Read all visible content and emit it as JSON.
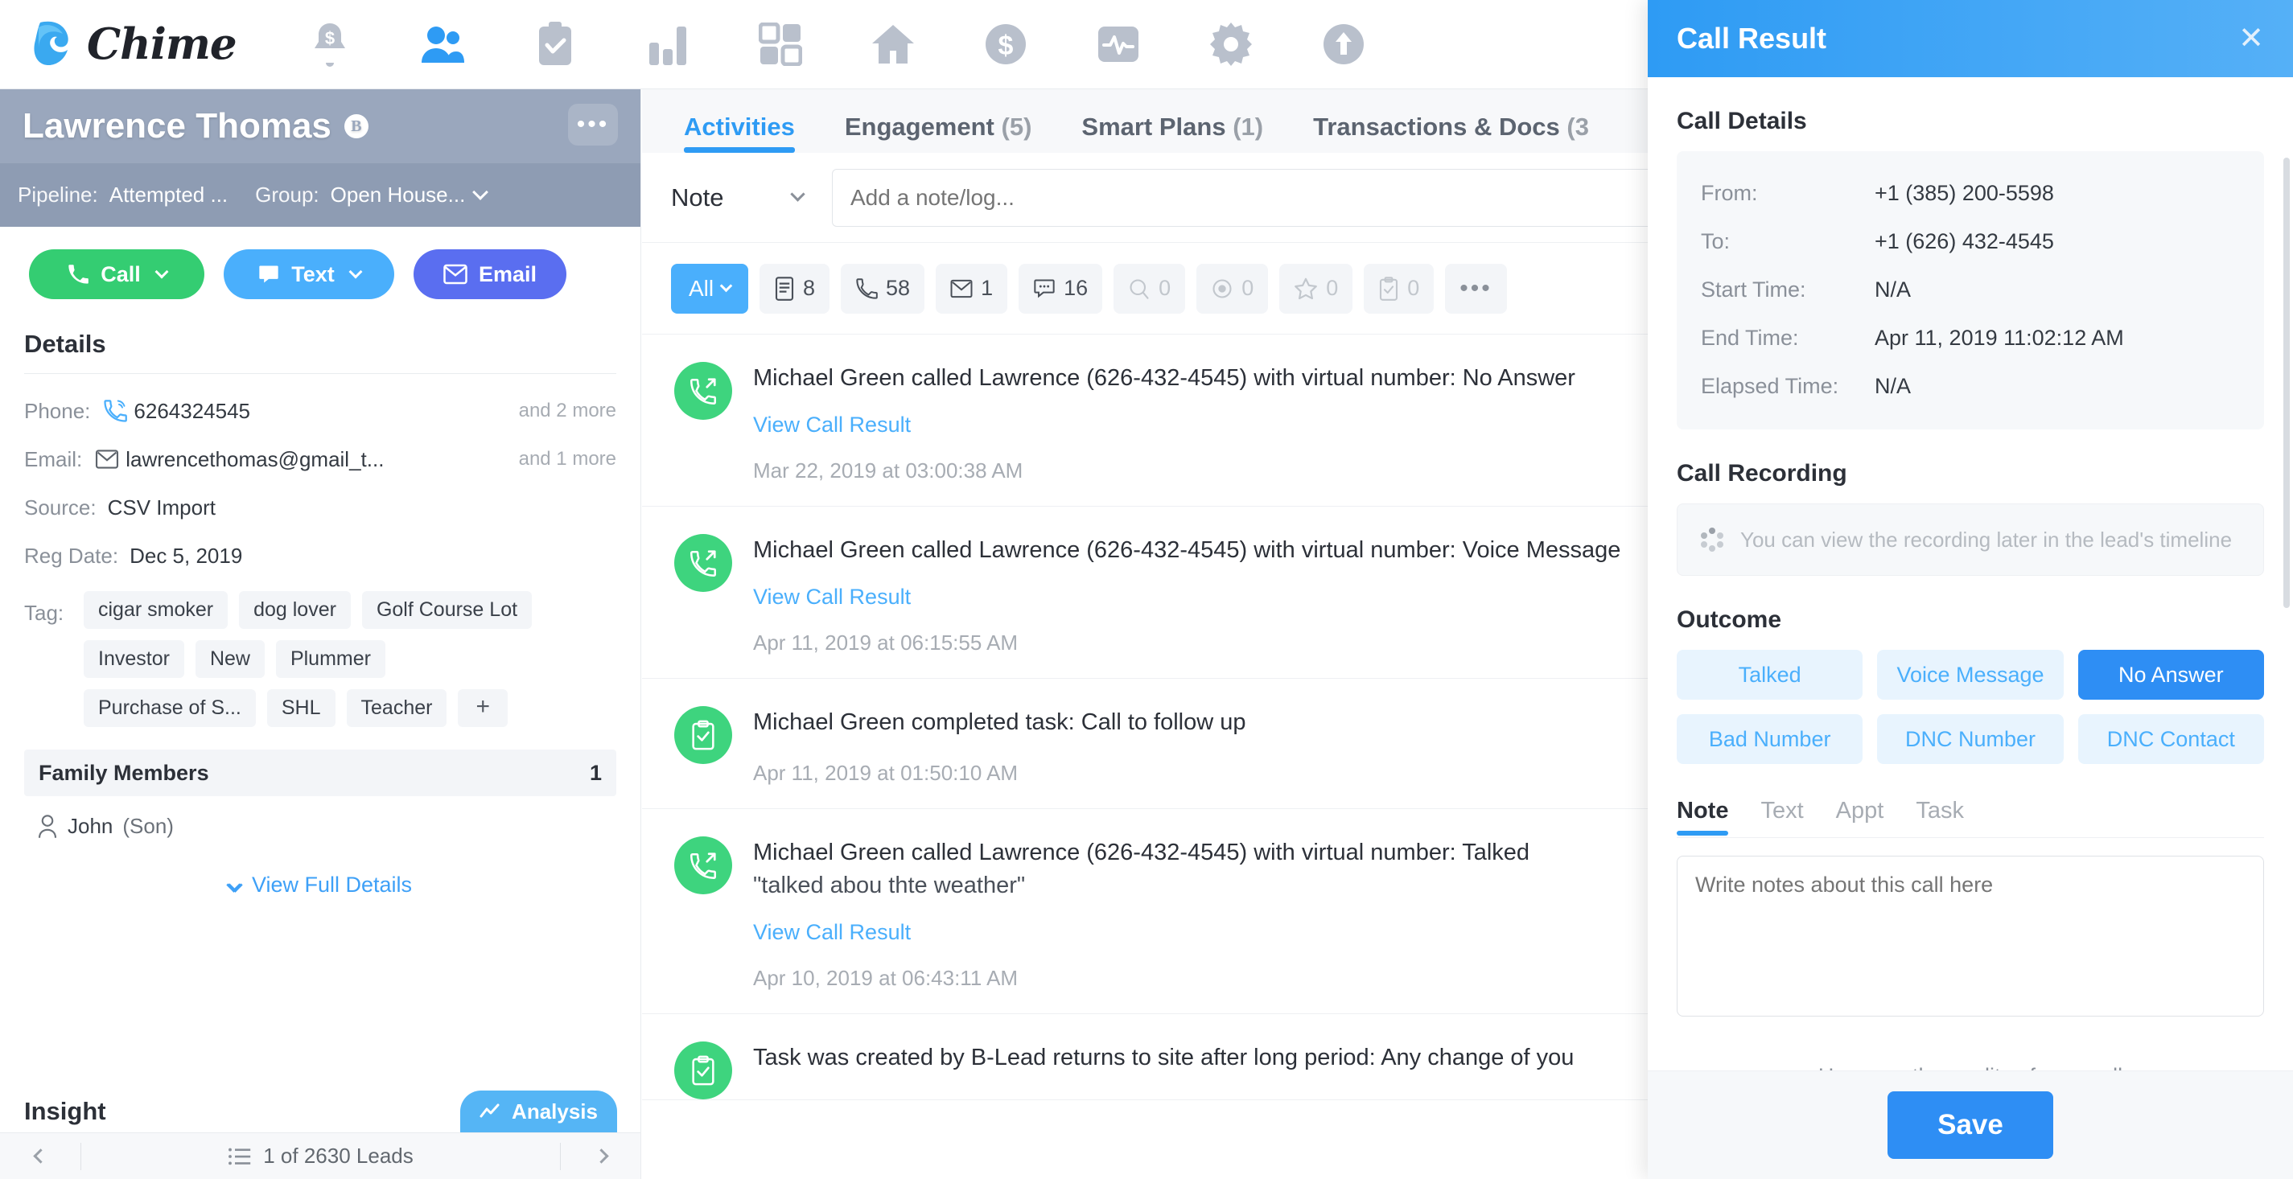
{
  "topnav": {
    "brand": "Chime",
    "icons": [
      {
        "name": "bell-dollar-icon",
        "label": "Notifications"
      },
      {
        "name": "people-icon",
        "label": "Leads"
      },
      {
        "name": "clipboard-check-icon",
        "label": "Tasks"
      },
      {
        "name": "bar-chart-icon",
        "label": "Reports"
      },
      {
        "name": "grid-apps-icon",
        "label": "Apps"
      },
      {
        "name": "home-icon",
        "label": "Listings"
      },
      {
        "name": "dollar-circle-icon",
        "label": "Deals"
      },
      {
        "name": "pulse-icon",
        "label": "Activity"
      },
      {
        "name": "gear-icon",
        "label": "Settings"
      },
      {
        "name": "upload-circle-icon",
        "label": "Import"
      }
    ]
  },
  "sidebar": {
    "lead_name": "Lawrence Thomas",
    "lead_badge": "B",
    "more_menu": "•••",
    "pipeline_label": "Pipeline:",
    "pipeline_value": "Attempted ...",
    "group_label": "Group:",
    "group_value": "Open House...",
    "actions": {
      "call": "Call",
      "text": "Text",
      "email": "Email"
    },
    "details_title": "Details",
    "details": [
      {
        "label": "Phone:",
        "value": "6264324545",
        "more": "and 2 more",
        "icon": "phone-wave-icon"
      },
      {
        "label": "Email:",
        "value": "lawrencethomas@gmail_t...",
        "more": "and 1 more",
        "icon": "envelope-icon"
      },
      {
        "label": "Source:",
        "value": "CSV Import",
        "more": "",
        "icon": ""
      },
      {
        "label": "Reg Date:",
        "value": "Dec 5, 2019",
        "more": "",
        "icon": ""
      }
    ],
    "tag_label": "Tag:",
    "tags": [
      "cigar smoker",
      "dog lover",
      "Golf Course Lot",
      "Investor",
      "New",
      "Plummer",
      "Purchase of S...",
      "SHL",
      "Teacher"
    ],
    "tag_add": "+",
    "family_title": "Family Members",
    "family_count": "1",
    "family_members": [
      {
        "name": "John",
        "relation": "(Son)"
      }
    ],
    "view_full_details": "View Full Details",
    "insight_title": "Insight",
    "analysis_button": "Analysis",
    "pager_text": "1 of 2630 Leads"
  },
  "main": {
    "tabs": [
      {
        "label": "Activities",
        "count": "",
        "active": true
      },
      {
        "label": "Engagement",
        "count": "(5)",
        "active": false
      },
      {
        "label": "Smart Plans",
        "count": "(1)",
        "active": false
      },
      {
        "label": "Transactions & Docs",
        "count": "(3",
        "active": false
      }
    ],
    "note_type": "Note",
    "note_placeholder": "Add a note/log...",
    "filters": [
      {
        "name": "filter-all",
        "label": "All",
        "count": "",
        "icon": "chevron-down-icon",
        "active": true,
        "dim": false
      },
      {
        "name": "filter-note",
        "label": "",
        "count": "8",
        "icon": "note-icon",
        "active": false,
        "dim": false
      },
      {
        "name": "filter-call",
        "label": "",
        "count": "58",
        "icon": "phone-icon",
        "active": false,
        "dim": false
      },
      {
        "name": "filter-email",
        "label": "",
        "count": "1",
        "icon": "envelope-icon",
        "active": false,
        "dim": false
      },
      {
        "name": "filter-text",
        "label": "",
        "count": "16",
        "icon": "chat-bubble-icon",
        "active": false,
        "dim": false
      },
      {
        "name": "filter-search",
        "label": "",
        "count": "0",
        "icon": "search-icon",
        "active": false,
        "dim": true
      },
      {
        "name": "filter-view",
        "label": "",
        "count": "0",
        "icon": "eye-target-icon",
        "active": false,
        "dim": true
      },
      {
        "name": "filter-favorite",
        "label": "",
        "count": "0",
        "icon": "star-icon",
        "active": false,
        "dim": true
      },
      {
        "name": "filter-task",
        "label": "",
        "count": "0",
        "icon": "clipboard-icon",
        "active": false,
        "dim": true
      },
      {
        "name": "filter-more",
        "label": "•••",
        "count": "",
        "icon": "ellipsis-icon",
        "active": false,
        "dim": false
      }
    ],
    "feed": [
      {
        "icon": "outgoing-call-icon",
        "title": "Michael Green called Lawrence (626-432-4545) with virtual number: No Answer",
        "sub": "",
        "link": "View Call Result",
        "time": "Mar 22, 2019 at 03:00:38 AM"
      },
      {
        "icon": "outgoing-call-icon",
        "title": "Michael Green called Lawrence (626-432-4545) with virtual number: Voice Message",
        "sub": "",
        "link": "View Call Result",
        "time": "Apr 11, 2019 at 06:15:55 AM"
      },
      {
        "icon": "clipboard-check-icon",
        "title": "Michael Green completed task: Call to follow up",
        "sub": "",
        "link": "",
        "time": "Apr 11, 2019 at 01:50:10 AM"
      },
      {
        "icon": "outgoing-call-icon",
        "title": "Michael Green called Lawrence (626-432-4545) with virtual number: Talked",
        "sub": "\"talked abou thte weather\"",
        "link": "View Call Result",
        "time": "Apr 10, 2019 at 06:43:11 AM"
      },
      {
        "icon": "clipboard-check-icon",
        "title": "Task was created by B-Lead returns to site after long period: Any change of you",
        "sub": "",
        "link": "",
        "time": ""
      }
    ]
  },
  "panel": {
    "title": "Call Result",
    "close": "✕",
    "call_details_title": "Call Details",
    "call_details": [
      {
        "label": "From:",
        "value": "+1 (385) 200-5598"
      },
      {
        "label": "To:",
        "value": "+1 (626) 432-4545"
      },
      {
        "label": "Start Time:",
        "value": "N/A"
      },
      {
        "label": "End Time:",
        "value": "Apr 11, 2019 11:02:12 AM"
      },
      {
        "label": "Elapsed Time:",
        "value": "N/A"
      }
    ],
    "recording_title": "Call Recording",
    "recording_text": "You can view the recording later in the lead's timeline",
    "outcome_title": "Outcome",
    "outcomes": [
      {
        "label": "Talked",
        "selected": false
      },
      {
        "label": "Voice Message",
        "selected": false
      },
      {
        "label": "No Answer",
        "selected": true
      },
      {
        "label": "Bad Number",
        "selected": false
      },
      {
        "label": "DNC Number",
        "selected": false
      },
      {
        "label": "DNC Contact",
        "selected": false
      }
    ],
    "note_tabs": [
      {
        "label": "Note",
        "active": true
      },
      {
        "label": "Text",
        "active": false
      },
      {
        "label": "Appt",
        "active": false
      },
      {
        "label": "Task",
        "active": false
      }
    ],
    "note_placeholder": "Write notes about this call here",
    "quality_question": "How was the quality of your call",
    "save_label": "Save"
  },
  "colors": {
    "accent": "#2e9bf4",
    "green": "#34cd72",
    "blue": "#4aaffc",
    "purple": "#5a6ef0",
    "panel_selected": "#2e8ef4",
    "header_slate": "#9aa7bd"
  }
}
